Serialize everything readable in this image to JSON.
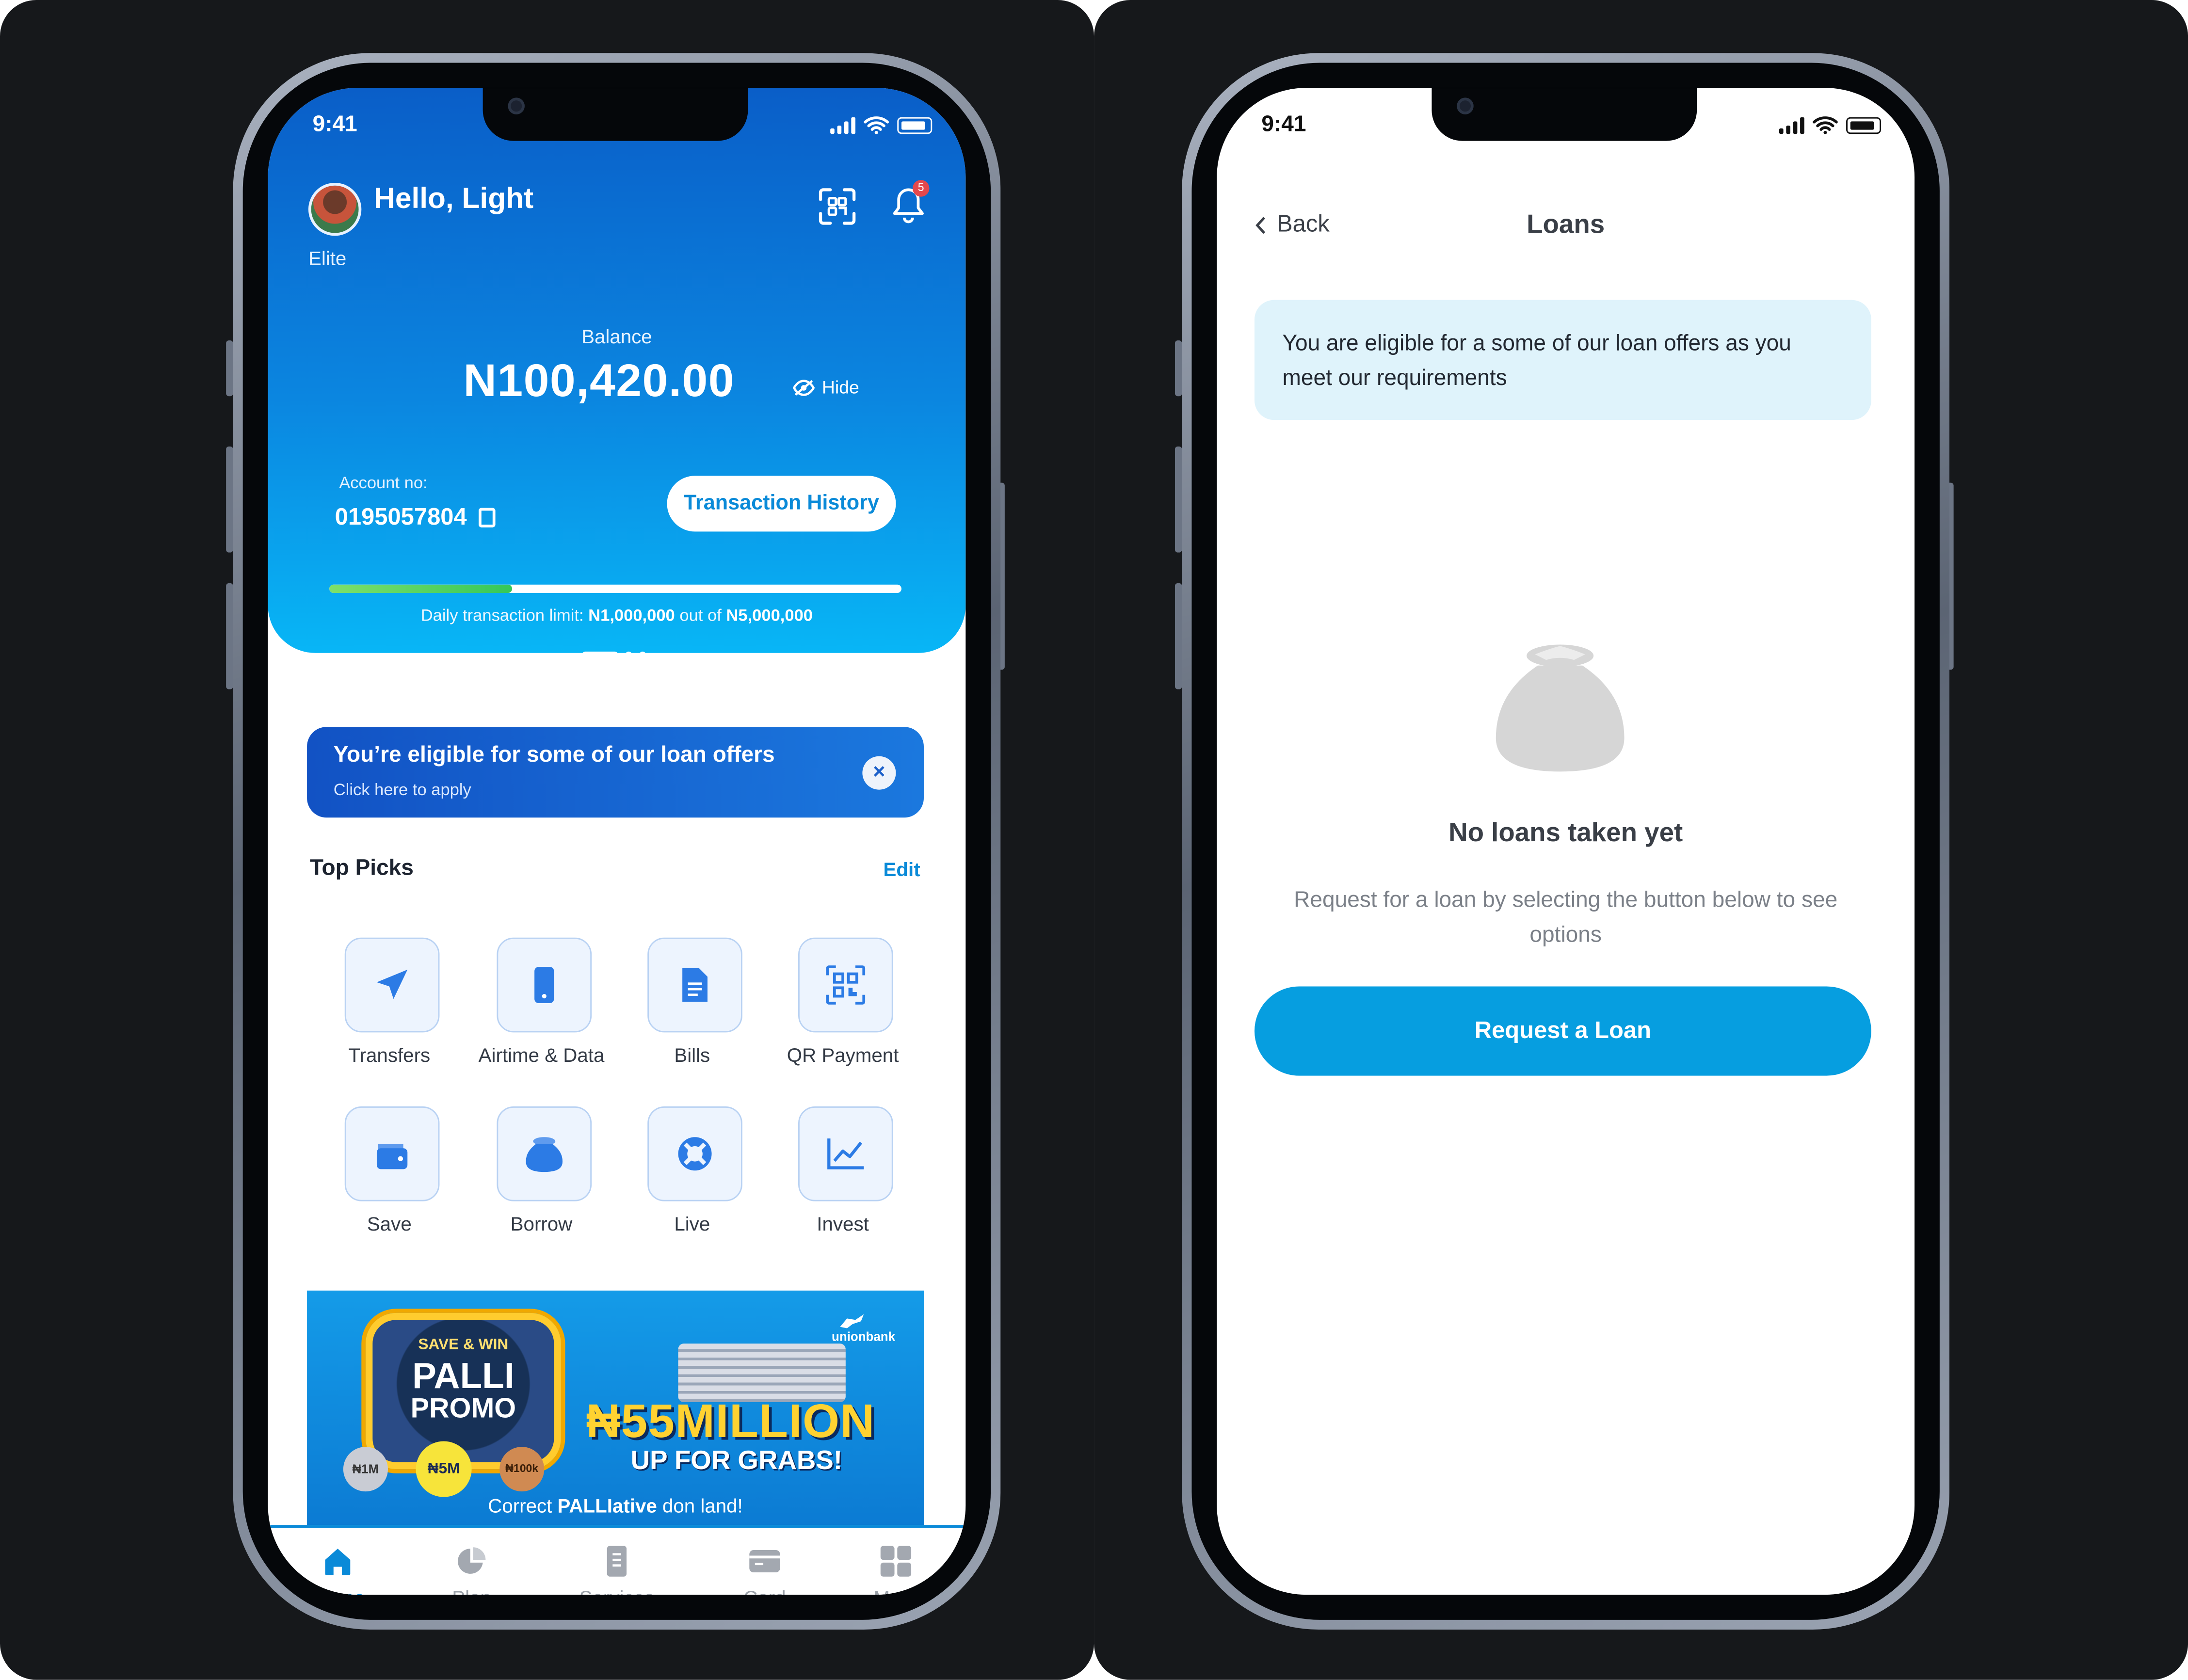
{
  "home": {
    "status_time": "9:41",
    "greeting": "Hello, Light",
    "tier": "Elite",
    "notification_count": "5",
    "balance_label": "Balance",
    "balance_amount": "N100,420.00",
    "hide_label": "Hide",
    "account_label": "Account no:",
    "account_number": "0195057804",
    "transaction_history_button": "Transaction History",
    "limit": {
      "prefix": "Daily transaction limit:",
      "used": "N1,000,000",
      "middle": "out of",
      "total": "N5,000,000",
      "progress_fraction": 0.32
    },
    "carousel_pages": 3,
    "carousel_active_index": 0,
    "loan_banner": {
      "title": "You’re eligible for some of our loan offers",
      "subtitle": "Click here to apply",
      "close_glyph": "×"
    },
    "top_picks_title": "Top Picks",
    "top_picks_edit": "Edit",
    "top_picks": [
      {
        "label": "Transfers",
        "icon": "send-icon"
      },
      {
        "label": "Airtime & Data",
        "icon": "phone-icon"
      },
      {
        "label": "Bills",
        "icon": "document-icon"
      },
      {
        "label": "QR Payment",
        "icon": "qr-code-icon"
      },
      {
        "label": "Save",
        "icon": "wallet-icon"
      },
      {
        "label": "Borrow",
        "icon": "money-bag-icon"
      },
      {
        "label": "Live",
        "icon": "lifebuoy-icon"
      },
      {
        "label": "Invest",
        "icon": "chart-icon"
      }
    ],
    "promo": {
      "line1": "SAVE & WIN",
      "line2": "PALLI",
      "line3": "PROMO",
      "headline": "₦55MILLION",
      "subheadline": "UP FOR GRABS!",
      "caption_prefix": "Correct",
      "caption_bold": "PALLIative",
      "caption_suffix": "don land!",
      "brand": "unionbank",
      "coin_1": "₦1M",
      "coin_2": "₦5M",
      "coin_3": "₦100k"
    },
    "tabs": [
      {
        "label": "Home",
        "icon": "home-icon",
        "active": true
      },
      {
        "label": "Plan",
        "icon": "pie-chart-icon",
        "active": false
      },
      {
        "label": "Services",
        "icon": "services-icon",
        "active": false
      },
      {
        "label": "Card",
        "icon": "card-icon",
        "active": false
      },
      {
        "label": "More",
        "icon": "grid-icon",
        "active": false
      }
    ]
  },
  "loans": {
    "status_time": "9:41",
    "back_label": "Back",
    "title": "Loans",
    "info_text": "You are eligible for a some of our loan offers as you meet our requirements",
    "empty_title": "No loans taken yet",
    "empty_subtitle": "Request for a loan by selecting the button below to see options",
    "request_button": "Request a Loan"
  },
  "colors": {
    "page_background": "#16181b",
    "primary_blue": "#0a8ad8",
    "hero_gradient_top": "#0a5ec8",
    "hero_gradient_bottom": "#08b6f6",
    "info_background": "#dff3fb",
    "progress_green": "#34c759"
  }
}
